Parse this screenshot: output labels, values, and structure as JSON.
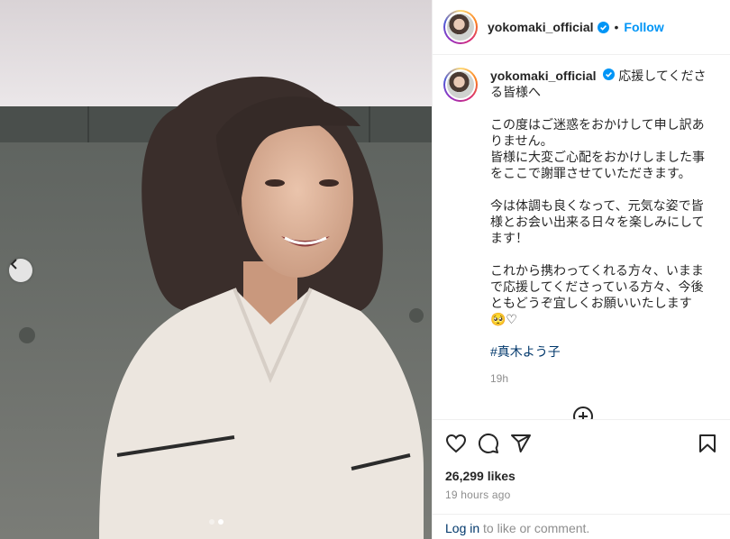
{
  "post": {
    "username": "yokomaki_official",
    "separator": "•",
    "follow_label": "Follow",
    "caption_first_line": "応援してくださる皆様へ",
    "caption_text": "この度はご迷惑をおかけして申し訳ありません。\n皆様に大変ご心配をおかけしました事をここで謝罪させていただきます。\n\n今は体調も良くなって、元気な姿で皆様とお会い出来る日々を楽しみにしてます！\n\nこれから携わってくれる方々、いままで応援してくださっている方々、今後ともどうぞ宜しくお願いいたします",
    "caption_emoji": "🥺♡",
    "hashtag": "#真木よう子",
    "caption_time": "19h",
    "likes": "26,299 likes",
    "posted_ago": "19 hours ago",
    "login_link": "Log in",
    "login_suffix": " to like or comment."
  },
  "carousel": {
    "slide_count": 2,
    "active_slide": 2
  },
  "colors": {
    "link_blue": "#0095f6",
    "hashtag": "#00376b",
    "muted": "#8e8e8e"
  },
  "icons": [
    "chevron-left-icon",
    "verified-badge-icon",
    "heart-icon",
    "comment-icon",
    "share-icon",
    "bookmark-icon",
    "plus-circle-icon"
  ]
}
